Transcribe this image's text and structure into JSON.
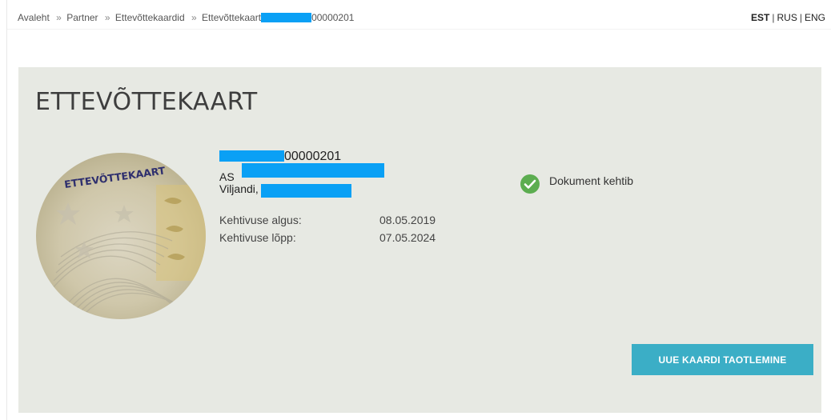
{
  "breadcrumb": {
    "items": [
      "Avaleht",
      "Partner",
      "Ettevõttekaardid",
      "Ettevõttekaart"
    ],
    "current_suffix": "00000201",
    "separator": "»"
  },
  "language": {
    "options": [
      "EST",
      "RUS",
      "ENG"
    ],
    "active": "EST",
    "divider": "|"
  },
  "card": {
    "title": "ETTEVÕTTEKAART",
    "image_label": "ETTEVÕTTEKAART",
    "document_number_suffix": "00000201",
    "company_prefix": "AS",
    "address_prefix": "Viljandi,",
    "valid_from_label": "Kehtivuse algus:",
    "valid_from": "08.05.2019",
    "valid_to_label": "Kehtivuse lõpp:",
    "valid_to": "07.05.2024",
    "status_text": "Dokument kehtib",
    "status_color": "#5cad50",
    "redaction_color": "#0aa0f5"
  },
  "actions": {
    "new_card_label": "UUE KAARDI TAOTLEMINE",
    "button_color": "#3baec6"
  }
}
